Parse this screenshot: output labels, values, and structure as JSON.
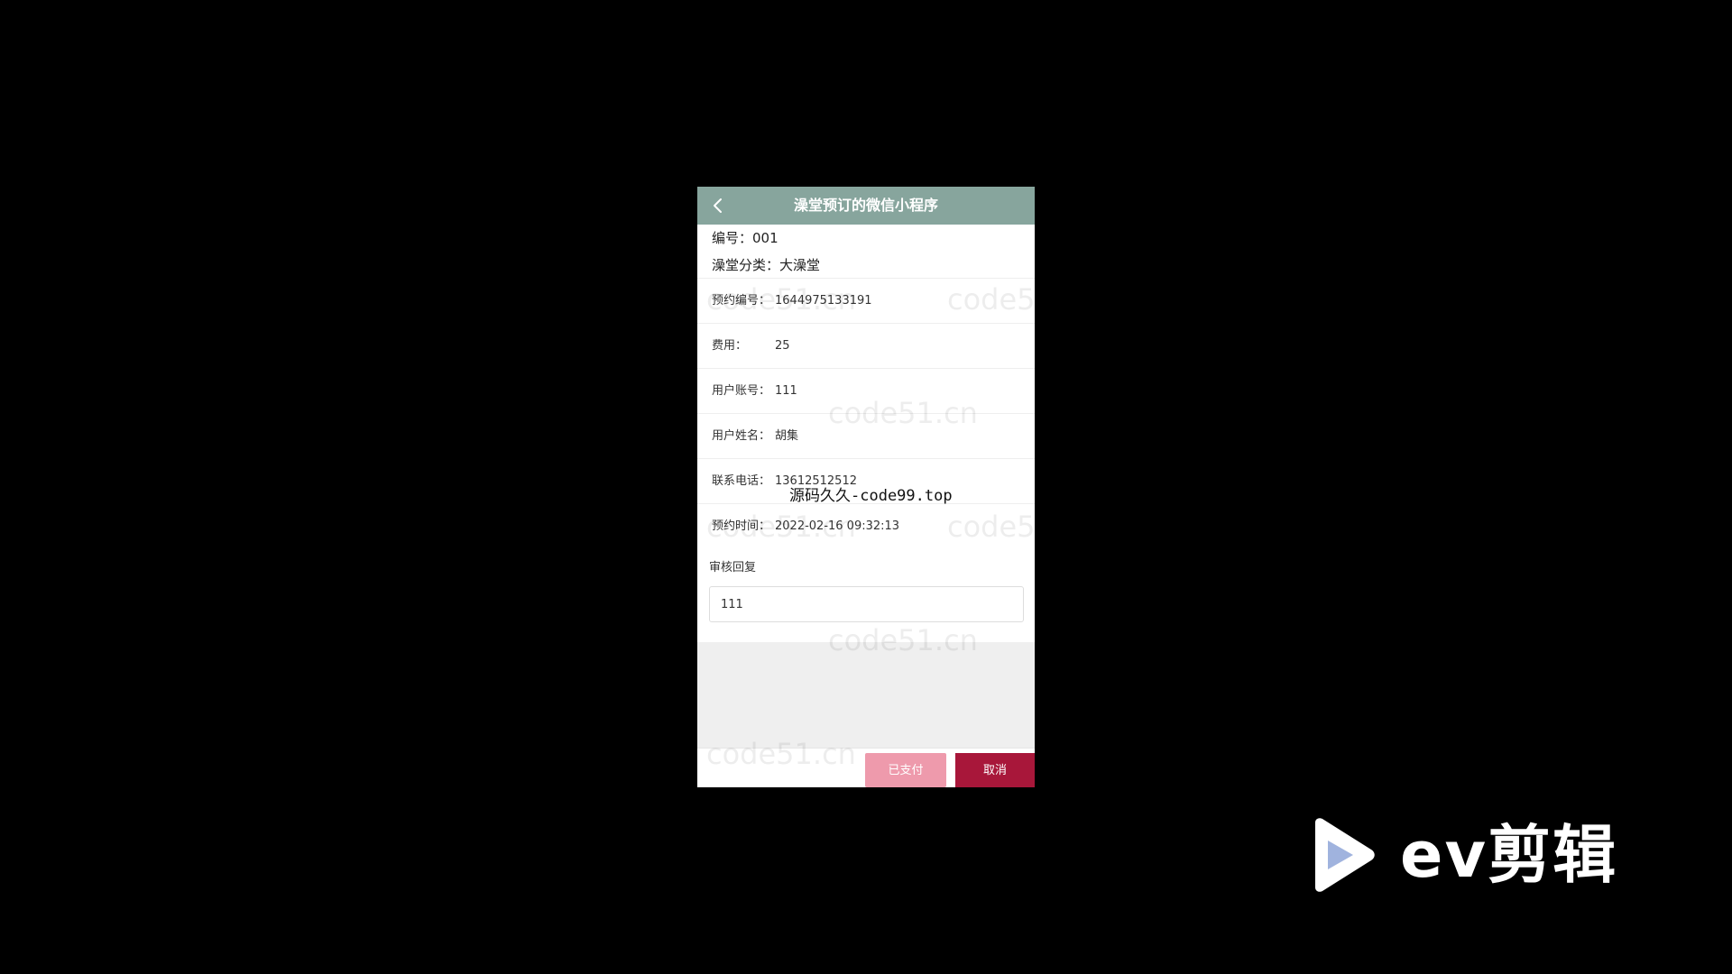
{
  "navbar": {
    "title": "澡堂预订的微信小程序",
    "back_icon": "chevron-left-icon"
  },
  "header": {
    "number_label": "编号：",
    "number_value": "001",
    "category_label": "澡堂分类：",
    "category_value": "大澡堂"
  },
  "details": [
    {
      "label": "预约编号：",
      "value": "1644975133191"
    },
    {
      "label": "费用：",
      "value": "25"
    },
    {
      "label": "用户账号：",
      "value": "111"
    },
    {
      "label": "用户姓名：",
      "value": "胡集"
    },
    {
      "label": "联系电话：",
      "value": "13612512512"
    },
    {
      "label": "预约时间：",
      "value": "2022-02-16 09:32:13"
    }
  ],
  "review": {
    "label": "审核回复",
    "value": "111"
  },
  "actions": {
    "paid_label": "已支付",
    "cancel_label": "取消"
  },
  "overlays": {
    "watermark_text": "code51.cn",
    "source_text": "源码久久-code99.top",
    "brand_text": "ev剪辑"
  },
  "colors": {
    "navbar": "#87a59d",
    "paid_button": "#ee9aac",
    "cancel_button": "#a8173a",
    "background": "#000000"
  }
}
